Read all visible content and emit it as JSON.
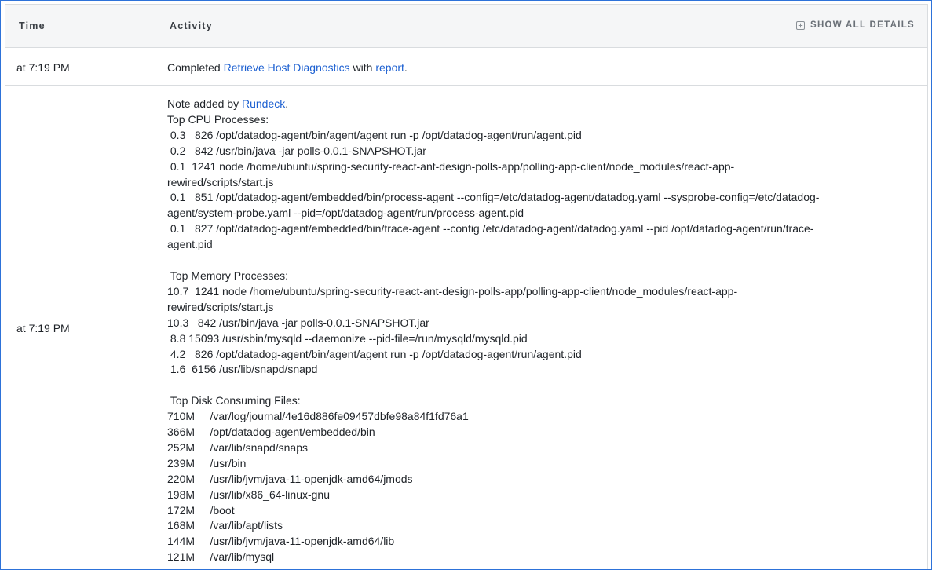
{
  "header": {
    "time_label": "Time",
    "activity_label": "Activity",
    "show_all_label": "SHOW ALL DETAILS",
    "show_all_icon": "plus-square-icon"
  },
  "rows": [
    {
      "time": "at 7:19 PM",
      "prefix": "Completed ",
      "job_link": "Retrieve Host Diagnostics",
      "middle": " with ",
      "report_link": "report",
      "suffix": "."
    },
    {
      "time": "at 7:19 PM",
      "note_prefix": "Note added by ",
      "note_author": "Rundeck",
      "note_suffix": ".",
      "note_body": "Top CPU Processes:\n 0.3   826 /opt/datadog-agent/bin/agent/agent run -p /opt/datadog-agent/run/agent.pid\n 0.2   842 /usr/bin/java -jar polls-0.0.1-SNAPSHOT.jar\n 0.1  1241 node /home/ubuntu/spring-security-react-ant-design-polls-app/polling-app-client/node_modules/react-app-rewired/scripts/start.js\n 0.1   851 /opt/datadog-agent/embedded/bin/process-agent --config=/etc/datadog-agent/datadog.yaml --sysprobe-config=/etc/datadog-agent/system-probe.yaml --pid=/opt/datadog-agent/run/process-agent.pid\n 0.1   827 /opt/datadog-agent/embedded/bin/trace-agent --config /etc/datadog-agent/datadog.yaml --pid /opt/datadog-agent/run/trace-agent.pid\n\n Top Memory Processes:\n10.7  1241 node /home/ubuntu/spring-security-react-ant-design-polls-app/polling-app-client/node_modules/react-app-rewired/scripts/start.js\n10.3   842 /usr/bin/java -jar polls-0.0.1-SNAPSHOT.jar\n 8.8 15093 /usr/sbin/mysqld --daemonize --pid-file=/run/mysqld/mysqld.pid\n 4.2   826 /opt/datadog-agent/bin/agent/agent run -p /opt/datadog-agent/run/agent.pid\n 1.6  6156 /usr/lib/snapd/snapd\n\n Top Disk Consuming Files:\n710M     /var/log/journal/4e16d886fe09457dbfe98a84f1fd76a1\n366M     /opt/datadog-agent/embedded/bin\n252M     /var/lib/snapd/snaps\n239M     /usr/bin\n220M     /usr/lib/jvm/java-11-openjdk-amd64/jmods\n198M     /usr/lib/x86_64-linux-gnu\n172M     /boot\n168M     /var/lib/apt/lists\n144M     /usr/lib/jvm/java-11-openjdk-amd64/lib\n121M     /var/lib/mysql"
    }
  ],
  "colors": {
    "link": "#1b5fd1",
    "header_bg": "#f5f6f7",
    "border": "#d9dcdf",
    "focus_outline": "#2d72d9"
  }
}
